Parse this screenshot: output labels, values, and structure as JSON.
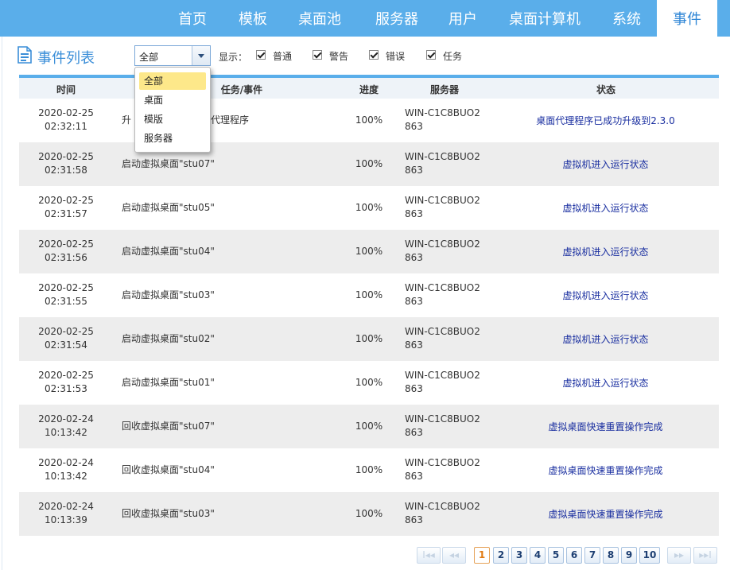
{
  "nav": {
    "items": [
      "首页",
      "模板",
      "桌面池",
      "服务器",
      "用户",
      "桌面计算机",
      "系统",
      "事件"
    ],
    "active_index": 7
  },
  "header": {
    "title": "事件列表",
    "filter_value": "全部",
    "show_label": "显示：",
    "checkboxes": [
      {
        "label": "普通",
        "checked": true
      },
      {
        "label": "警告",
        "checked": true
      },
      {
        "label": "错误",
        "checked": true
      },
      {
        "label": "任务",
        "checked": true
      }
    ]
  },
  "dropdown": {
    "options": [
      "全部",
      "桌面",
      "模版",
      "服务器"
    ],
    "selected_index": 0
  },
  "table": {
    "columns": [
      "时间",
      "任务/事件",
      "进度",
      "服务器",
      "状态"
    ],
    "rows": [
      {
        "date": "2020-02-25",
        "time": "02:32:11",
        "task_prefix": "升",
        "task": "代理程序",
        "progress": "100%",
        "server1": "WIN-C1C8BUO2",
        "server2": "863",
        "status": "桌面代理程序已成功升级到2.3.0"
      },
      {
        "date": "2020-02-25",
        "time": "02:31:58",
        "task": "启动虚拟桌面\"stu07\"",
        "progress": "100%",
        "server1": "WIN-C1C8BUO2",
        "server2": "863",
        "status": "虚拟机进入运行状态"
      },
      {
        "date": "2020-02-25",
        "time": "02:31:57",
        "task": "启动虚拟桌面\"stu05\"",
        "progress": "100%",
        "server1": "WIN-C1C8BUO2",
        "server2": "863",
        "status": "虚拟机进入运行状态"
      },
      {
        "date": "2020-02-25",
        "time": "02:31:56",
        "task": "启动虚拟桌面\"stu04\"",
        "progress": "100%",
        "server1": "WIN-C1C8BUO2",
        "server2": "863",
        "status": "虚拟机进入运行状态"
      },
      {
        "date": "2020-02-25",
        "time": "02:31:55",
        "task": "启动虚拟桌面\"stu03\"",
        "progress": "100%",
        "server1": "WIN-C1C8BUO2",
        "server2": "863",
        "status": "虚拟机进入运行状态"
      },
      {
        "date": "2020-02-25",
        "time": "02:31:54",
        "task": "启动虚拟桌面\"stu02\"",
        "progress": "100%",
        "server1": "WIN-C1C8BUO2",
        "server2": "863",
        "status": "虚拟机进入运行状态"
      },
      {
        "date": "2020-02-25",
        "time": "02:31:53",
        "task": "启动虚拟桌面\"stu01\"",
        "progress": "100%",
        "server1": "WIN-C1C8BUO2",
        "server2": "863",
        "status": "虚拟机进入运行状态"
      },
      {
        "date": "2020-02-24",
        "time": "10:13:42",
        "task": "回收虚拟桌面\"stu07\"",
        "progress": "100%",
        "server1": "WIN-C1C8BUO2",
        "server2": "863",
        "status": "虚拟桌面快速重置操作完成"
      },
      {
        "date": "2020-02-24",
        "time": "10:13:42",
        "task": "回收虚拟桌面\"stu04\"",
        "progress": "100%",
        "server1": "WIN-C1C8BUO2",
        "server2": "863",
        "status": "虚拟桌面快速重置操作完成"
      },
      {
        "date": "2020-02-24",
        "time": "10:13:39",
        "task": "回收虚拟桌面\"stu03\"",
        "progress": "100%",
        "server1": "WIN-C1C8BUO2",
        "server2": "863",
        "status": "虚拟桌面快速重置操作完成"
      }
    ]
  },
  "pagination": {
    "first": "I◂◂",
    "prev": "◂◂",
    "next": "▸▸",
    "last": "▸▸I",
    "pages": [
      "1",
      "2",
      "3",
      "4",
      "5",
      "6",
      "7",
      "8",
      "9",
      "10"
    ],
    "current": "1"
  }
}
